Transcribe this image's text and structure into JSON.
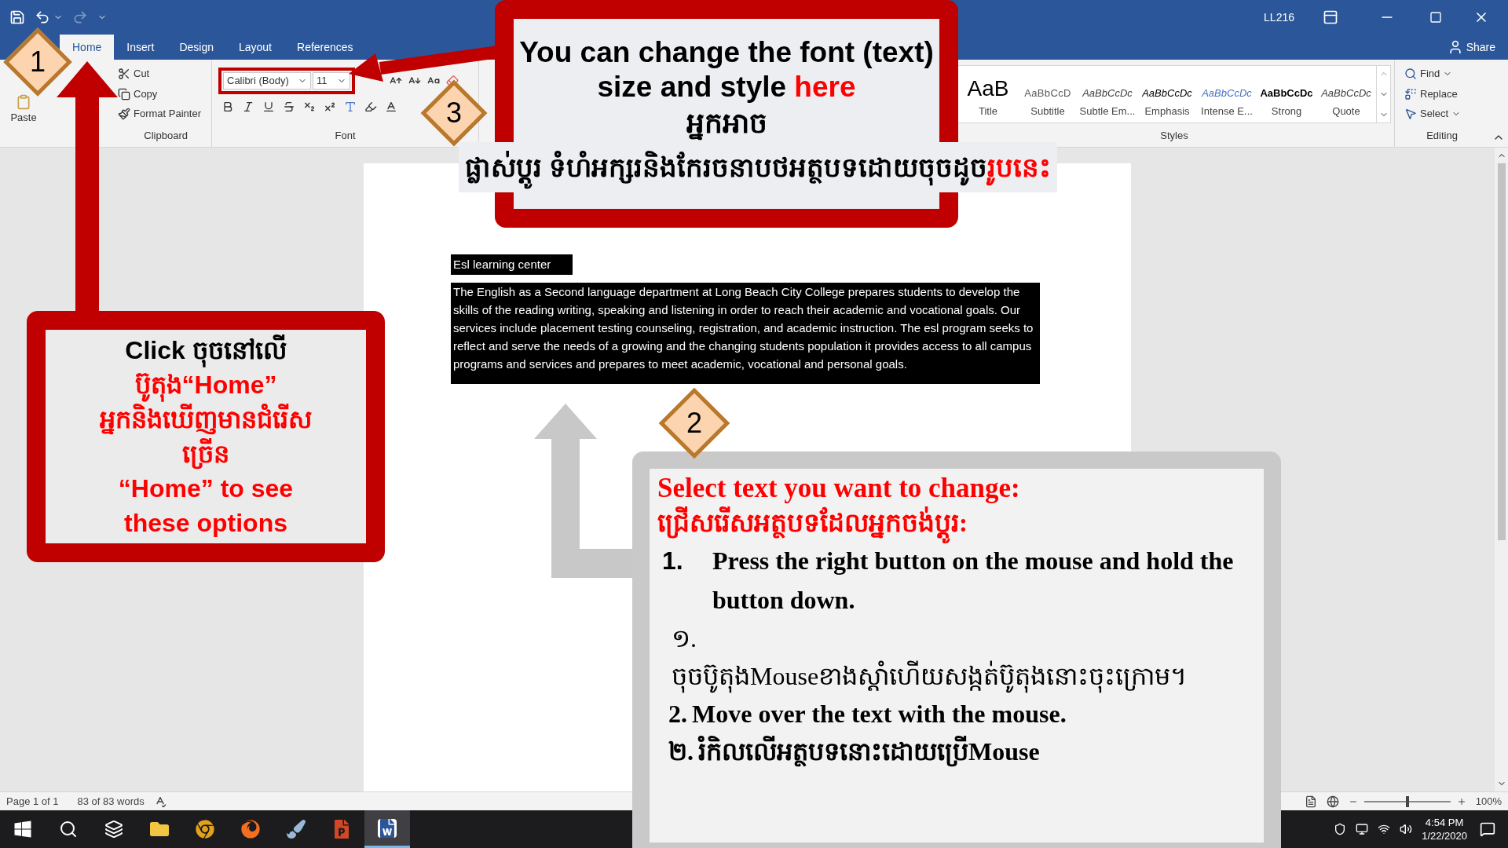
{
  "quick_access": {
    "redo": {
      "disabled": true
    }
  },
  "title_bar": {
    "account": "LL216"
  },
  "tabs": [
    {
      "label": "Home",
      "selected": true
    },
    {
      "label": "Insert",
      "selected": false
    },
    {
      "label": "Design",
      "selected": false
    },
    {
      "label": "Layout",
      "selected": false
    },
    {
      "label": "References",
      "selected": false
    }
  ],
  "share": "Share",
  "ribbon": {
    "clipboard": {
      "paste": "Paste",
      "items": [
        {
          "label": "Cut",
          "kind": "cut"
        },
        {
          "label": "Copy",
          "kind": "copy"
        },
        {
          "label": "Format Painter",
          "kind": "painter"
        }
      ],
      "label": "Clipboard"
    },
    "font": {
      "name": "Calibri (Body)",
      "size": "11",
      "label": "Font"
    },
    "styles": {
      "items": [
        {
          "sample": "AaB",
          "name": "Title",
          "kind": "title"
        },
        {
          "sample": "AaBbCcD",
          "name": "Subtitle",
          "kind": "subtitle"
        },
        {
          "sample": "AaBbCcDc",
          "name": "Subtle Em...",
          "kind": "subtle"
        },
        {
          "sample": "AaBbCcDc",
          "name": "Emphasis",
          "kind": "emphasis"
        },
        {
          "sample": "AaBbCcDc",
          "name": "Intense E...",
          "kind": "intense"
        },
        {
          "sample": "AaBbCcDc",
          "name": "Strong",
          "kind": "strong"
        },
        {
          "sample": "AaBbCcDc",
          "name": "Quote",
          "kind": "quote"
        }
      ],
      "label": "Styles"
    },
    "editing": {
      "items": [
        {
          "label": "Find",
          "kind": "find"
        },
        {
          "label": "Replace",
          "kind": "replace"
        },
        {
          "label": "Select",
          "kind": "select"
        }
      ],
      "label": "Editing"
    }
  },
  "document": {
    "heading": "Esl learning center",
    "body": "The English as a Second language department at Long Beach City College prepares students to develop the skills of the reading writing, speaking and listening in order to reach their academic and vocational goals. Our services include placement testing counseling, registration, and academic instruction. The esl program seeks to reflect and serve the needs of a growing and the changing students population it provides access to all campus programs and services and prepares to meet academic, vocational and personal goals."
  },
  "status_bar": {
    "page": "Page 1 of 1",
    "words": "83 of 83 words",
    "zoom": {
      "reading": "100%",
      "level": 0.5
    }
  },
  "taskbar": {
    "apps": [
      {
        "kind": "start",
        "selected": false
      },
      {
        "kind": "search",
        "selected": false
      },
      {
        "kind": "taskview",
        "selected": false
      },
      {
        "kind": "explorer",
        "selected": false
      },
      {
        "kind": "chrome",
        "selected": false
      },
      {
        "kind": "firefox",
        "selected": false
      },
      {
        "kind": "paint",
        "selected": false
      },
      {
        "kind": "powerpoint",
        "selected": false
      },
      {
        "kind": "word",
        "selected": true
      }
    ],
    "time": "4:54 PM",
    "date": "1/22/2020"
  },
  "callouts": {
    "font_tip": {
      "badge": "3",
      "title": "You can change the font (text) size and style",
      "highlight": "here",
      "khmer_title": "អ្នកអាច",
      "khmer_line": "ផ្លាស់ប្តូរ ទំហំអក្សរនិងកែរចនាបថអត្ថបទដោយចុចដូច",
      "khmer_highlight": "រូបនេះ"
    },
    "home_tip": {
      "badge": "1",
      "lead": "Click ចុចនៅលើ",
      "lines": [
        "ប៊ូតុង“Home”",
        "អ្នកនិងឃើញមានជំរើស",
        "ច្រើន",
        "“Home” to see",
        "these options"
      ]
    },
    "select_tip": {
      "badge": "2",
      "title": "Select text you want to change:",
      "khmer_title": "ជ្រើសរើសអត្ថបទដែលអ្នកចង់ប្តូរ:",
      "steps": [
        {
          "kind": "hanging",
          "number": "1.",
          "text": "Press the right button on the mouse and hold the button down."
        },
        {
          "kind": "stacked",
          "number": "១.",
          "text": "ចុចប៊ូតុងMouseខាងស្តាំហើយសង្កត់ប៊ូតុងនោះចុះក្រោម។"
        },
        {
          "kind": "inline",
          "number": "2.",
          "text": "Move over the text with the mouse."
        },
        {
          "kind": "inline",
          "number": "២.",
          "text": "រំកិលលើអត្ថបទនោះដោយប្រើMouse"
        }
      ]
    }
  }
}
